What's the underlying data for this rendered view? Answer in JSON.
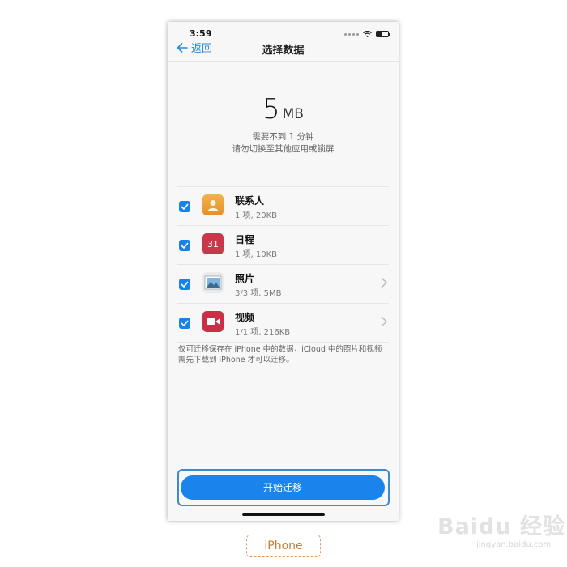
{
  "status": {
    "time": "3:59"
  },
  "nav": {
    "back_label": "返回",
    "title": "选择数据"
  },
  "summary": {
    "size_value": "5",
    "size_unit": "MB",
    "hint_line1": "需要不到 1 分钟",
    "hint_line2": "请勿切换至其他应用或锁屏"
  },
  "items": [
    {
      "name": "联系人",
      "meta": "1 项, 20KB",
      "checked": true,
      "icon": "contacts-icon"
    },
    {
      "name": "日程",
      "meta": "1 项, 10KB",
      "checked": true,
      "icon": "calendar-icon",
      "icon_text": "31"
    },
    {
      "name": "照片",
      "meta": "3/3 项, 5MB",
      "checked": true,
      "icon": "photos-icon"
    },
    {
      "name": "视频",
      "meta": "1/1 项, 216KB",
      "checked": true,
      "icon": "video-icon"
    }
  ],
  "note": "仅可迁移保存在 iPhone 中的数据，iCloud 中的照片和视频需先下载到 iPhone 才可以迁移。",
  "start_button": "开始迁移",
  "caption": "iPhone",
  "watermark": {
    "logo": "Baidu 经验",
    "sub": "jingyan.baidu.com"
  },
  "colors": {
    "accent": "#1a84ec",
    "link": "#2a8ad8",
    "calendar": "#c9384a",
    "contacts": "#e9a03a"
  }
}
